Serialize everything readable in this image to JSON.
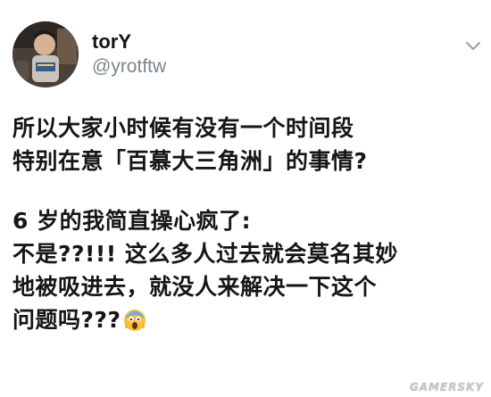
{
  "user": {
    "display_name": "torY",
    "handle": "@yrotftw",
    "avatar_icon": "profile-photo"
  },
  "menu": {
    "icon": "chevron-down-icon"
  },
  "tweet": {
    "paragraph1": [
      "所以大家小时候有没有一个时间段",
      "特别在意「百慕大三角洲」的事情?"
    ],
    "paragraph2": [
      "6 岁的我简直操心疯了:",
      "不是??!!! 这么多人过去就会莫名其妙",
      "地被吸进去，就没人来解决一下这个",
      "问题吗???"
    ],
    "emoji": "screaming-face-emoji"
  },
  "watermark": "GAMERSKY",
  "colors": {
    "text": "#161616",
    "handle": "#7a8690",
    "background": "#ffffff"
  }
}
